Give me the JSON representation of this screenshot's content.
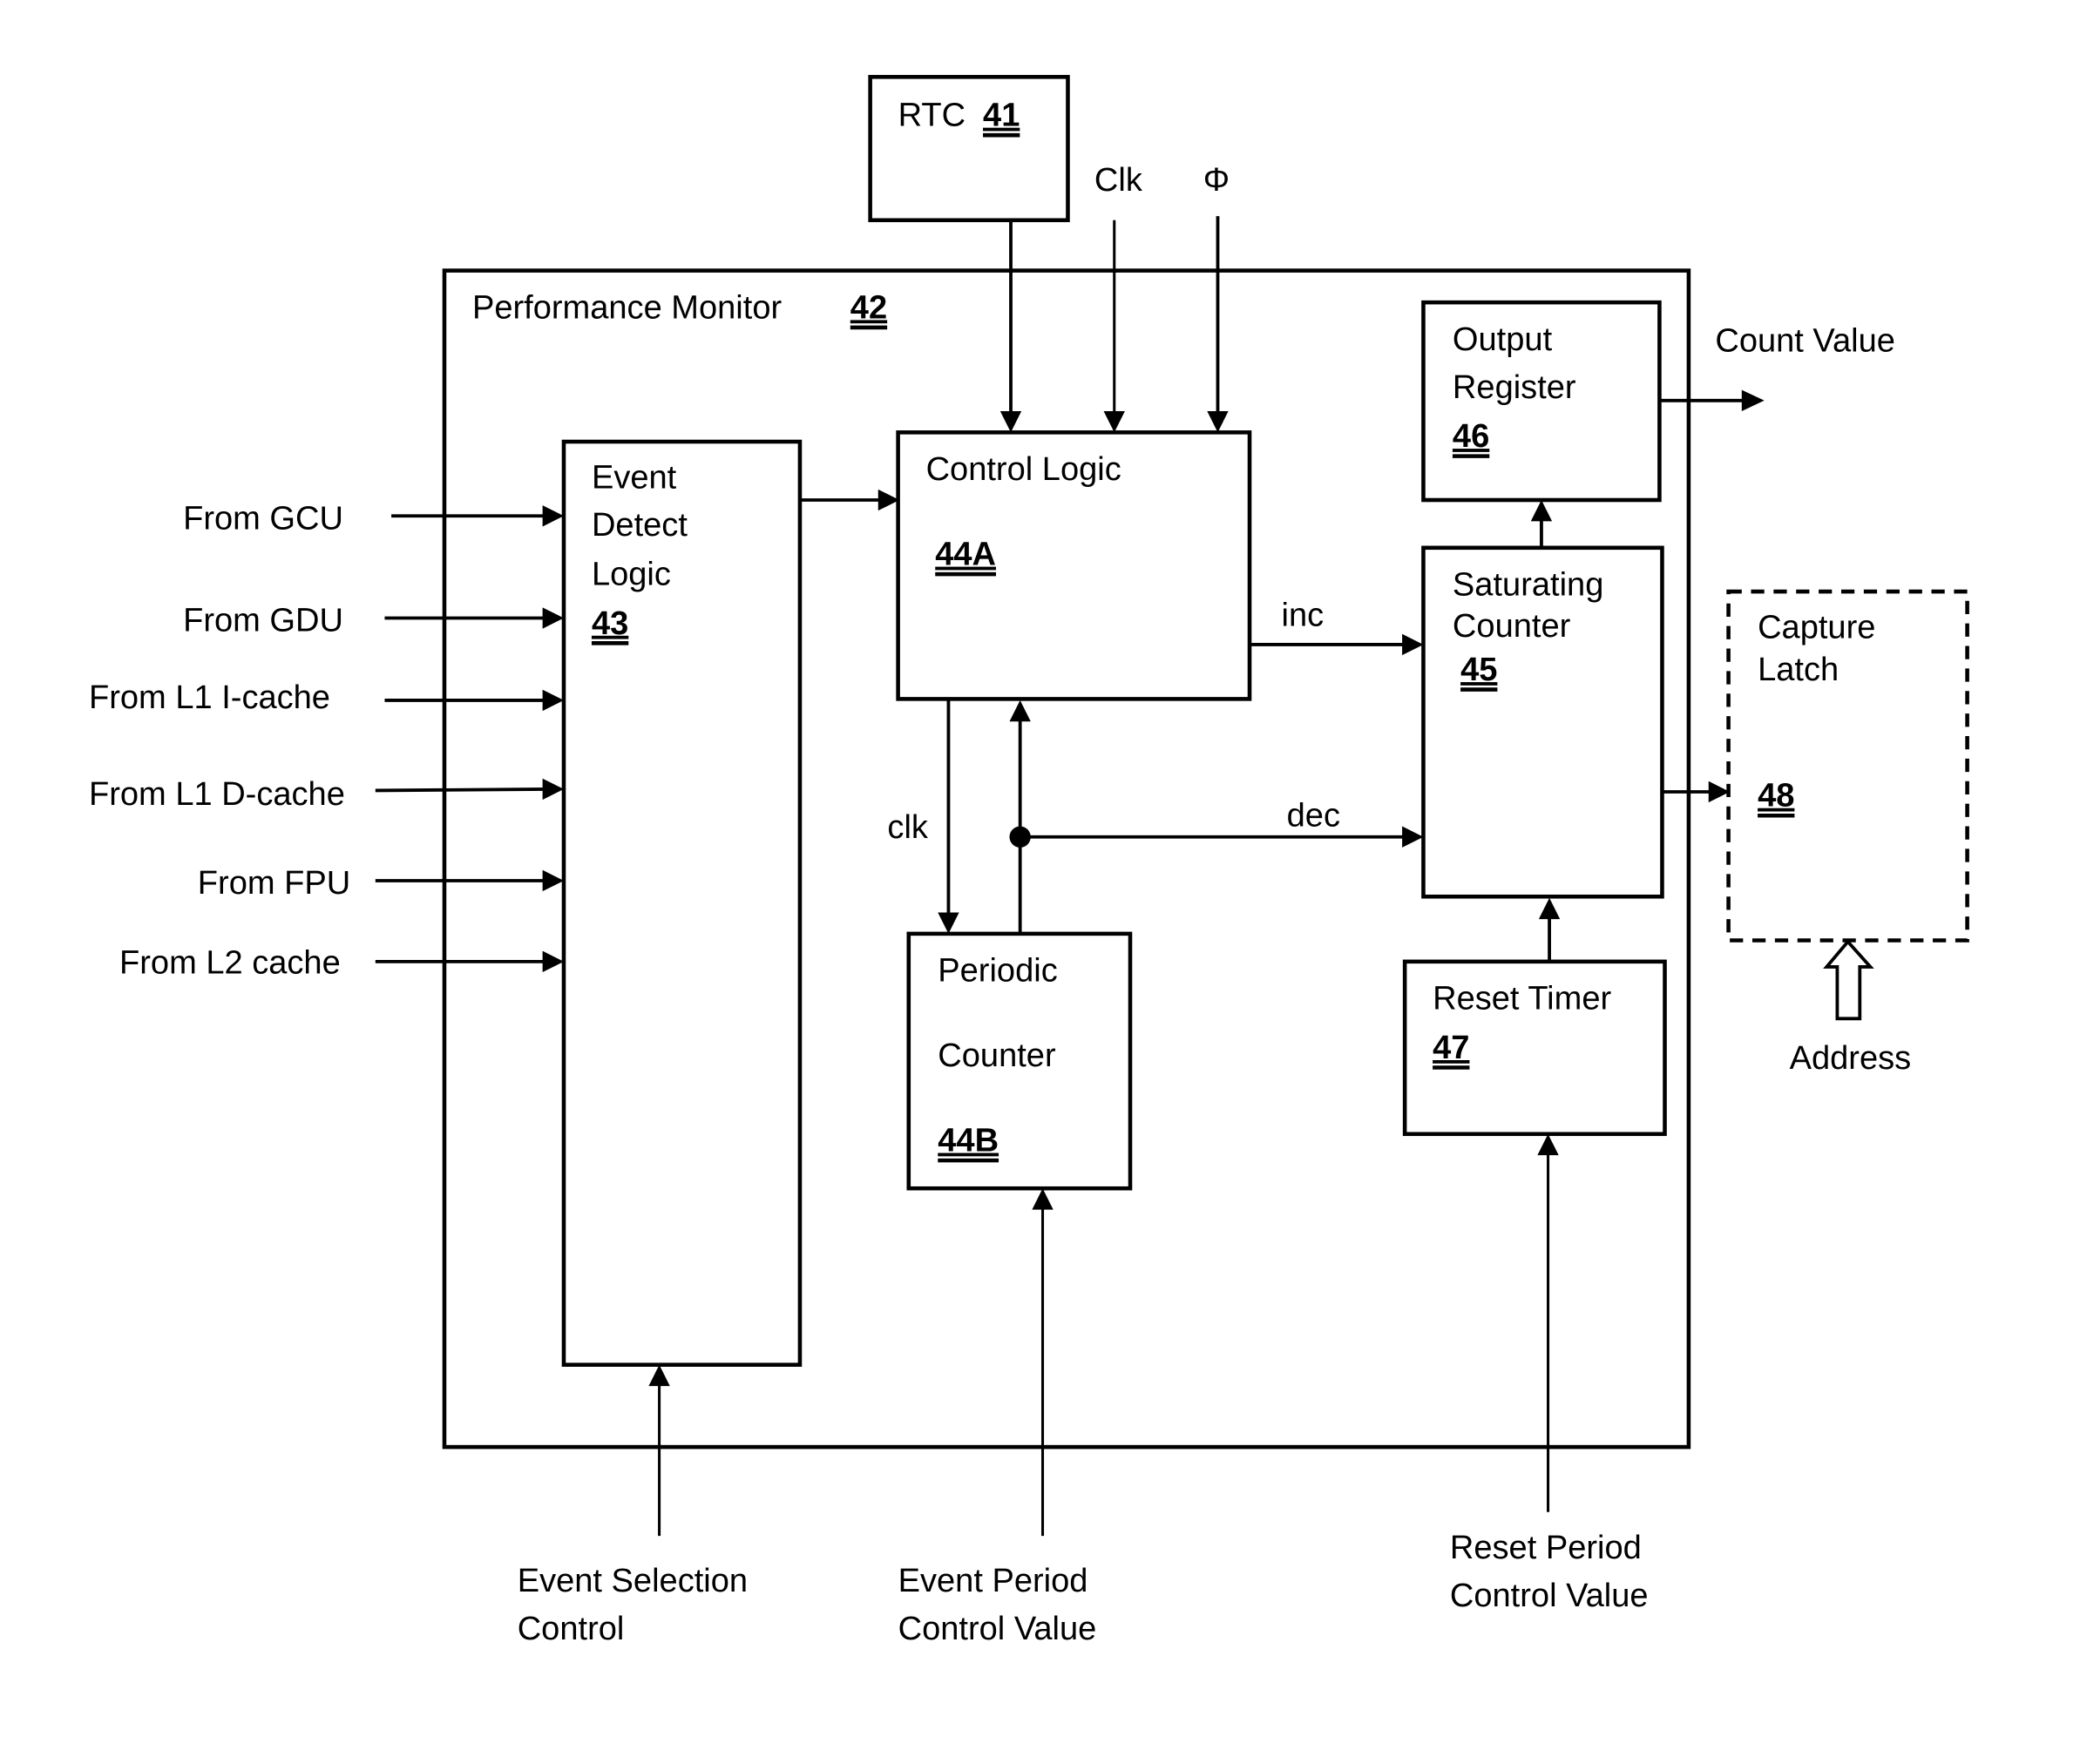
{
  "figure": {
    "title": "Performance Monitor block diagram",
    "colors": {
      "line": "#000000",
      "background": "#ffffff"
    }
  },
  "blocks": {
    "rtc": {
      "label": "RTC",
      "ref": "41"
    },
    "performance_monitor": {
      "label": "Performance Monitor",
      "ref": "42"
    },
    "event_detect": {
      "lines": [
        "Event",
        "Detect",
        "Logic"
      ],
      "ref": "43"
    },
    "control_logic": {
      "label": "Control Logic",
      "ref": "44A"
    },
    "periodic_counter": {
      "lines": [
        "Periodic",
        "Counter"
      ],
      "ref": "44B"
    },
    "saturating_counter": {
      "lines": [
        "Saturating",
        "Counter"
      ],
      "ref": "45"
    },
    "output_register": {
      "lines": [
        "Output",
        "Register"
      ],
      "ref": "46"
    },
    "reset_timer": {
      "label": "Reset Timer",
      "ref": "47"
    },
    "capture_latch": {
      "lines": [
        "Capture",
        "Latch"
      ],
      "ref": "48"
    }
  },
  "signals": {
    "clk_in": "Clk",
    "phi_in": "Φ",
    "inc": "inc",
    "dec": "dec",
    "clk_internal": "clk",
    "count_value": "Count Value",
    "address": "Address"
  },
  "inputs_left": [
    "From GCU",
    "From GDU",
    "From L1 I-cache",
    "From L1 D-cache",
    "From FPU",
    "From L2 cache"
  ],
  "inputs_bottom": {
    "event_selection": [
      "Event Selection",
      "Control"
    ],
    "event_period": [
      "Event Period",
      "Control Value"
    ],
    "reset_period": [
      "Reset Period",
      "Control Value"
    ]
  }
}
